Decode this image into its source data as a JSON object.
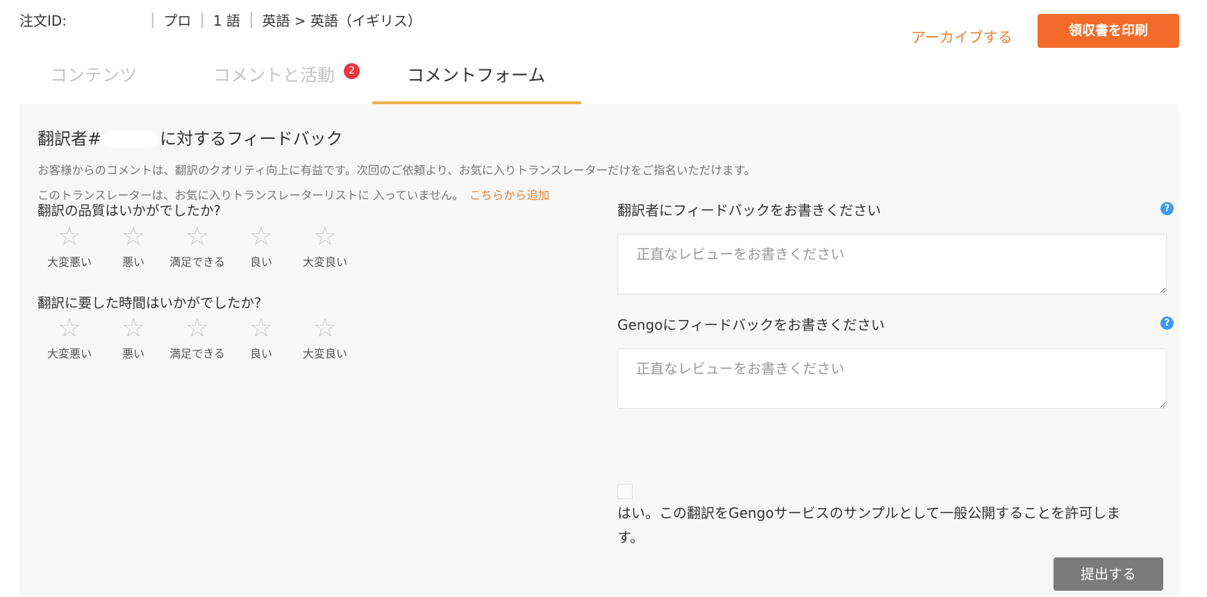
{
  "header": {
    "order_id_label": "注文ID:",
    "plan": "プロ",
    "language_count": "1 語",
    "language_pair": "英語 > 英語（イギリス）",
    "archive_label": "アーカイブする",
    "print_receipt_label": "領収書を印刷"
  },
  "tabs": [
    {
      "label": "コンテンツ"
    },
    {
      "label": "コメントと活動",
      "badge": "2"
    },
    {
      "label": "コメントフォーム"
    }
  ],
  "form": {
    "title_prefix": "翻訳者#",
    "title_suffix": "に対するフィードバック",
    "intro": "お客様からのコメントは、翻訳のクオリティ向上に有益です。次回のご依頼より、お気に入りトランスレーターだけをご指名いただけます。",
    "favorite_notice": "このトランスレーターは、お気に入りトランスレーターリストに 入っていません。",
    "add_favorite_link": "こちらから追加",
    "quality_question": "翻訳の品質はいかがでしたか?",
    "time_question": "翻訳に要した時間はいかがでしたか?",
    "rating_labels": [
      "大変悪い",
      "悪い",
      "満足できる",
      "良い",
      "大変良い"
    ],
    "star_glyph": "☆",
    "translator_feedback_label": "翻訳者にフィードバックをお書きください",
    "gengo_feedback_label": "Gengoにフィードバックをお書きください",
    "textarea_placeholder": "正直なレビューをお書きください",
    "help_glyph": "?",
    "sample_consent": "はい。この翻訳をGengoサービスのサンプルとして一般公開することを許可します。",
    "submit_label": "提出する"
  },
  "colors": {
    "accent_orange": "#f26b2a",
    "link_orange": "#e8802f",
    "tab_underline": "#f2b04a",
    "badge_red": "#e8383c",
    "help_blue": "#3d9be9",
    "submit_gray": "#7a7a7a"
  }
}
